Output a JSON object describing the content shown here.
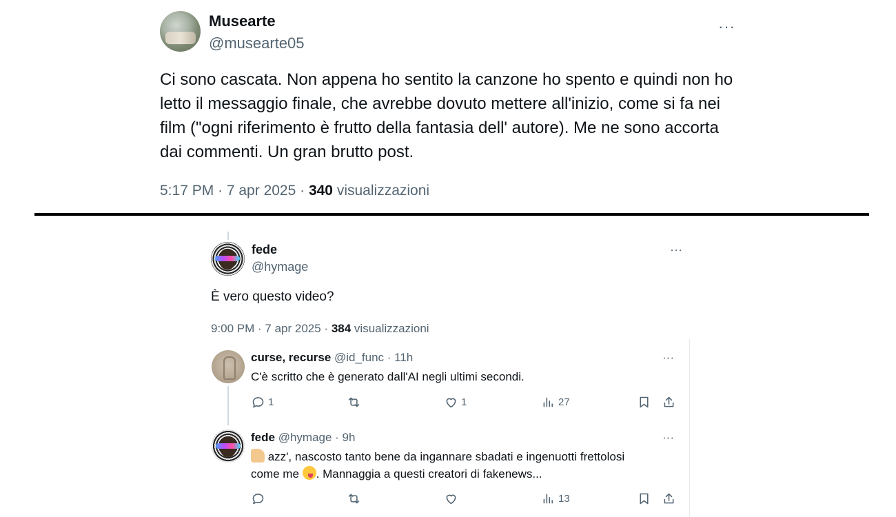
{
  "top_tweet": {
    "name": "Musearte",
    "handle": "@musearte05",
    "more": "···",
    "text": "Ci sono cascata. Non appena ho sentito la canzone ho spento e quindi non ho letto il messaggio finale, che avrebbe dovuto mettere all'inizio, come si fa nei film (\"ogni riferimento è frutto della fantasia dell' autore). Me ne sono accorta dai commenti. Un gran brutto post.",
    "time": "5:17 PM · 7 apr 2025 · ",
    "views": "340",
    "views_label": " visualizzazioni"
  },
  "second_tweet": {
    "name": "fede",
    "handle": "@hymage",
    "more": "···",
    "text": "È vero questo video?",
    "time": "9:00 PM · 7 apr 2025 · ",
    "views": "384",
    "views_label": " visualizzazioni"
  },
  "replies": [
    {
      "name": "curse, recurse",
      "meta": " @id_func · 11h",
      "more": "···",
      "text": "C'è scritto che è generato dall'AI negli ultimi secondi.",
      "reply_count": "1",
      "retweet_count": "",
      "like_count": "1",
      "view_count": "27"
    },
    {
      "name": "fede",
      "meta": " @hymage · 9h",
      "more": "···",
      "text_part1": " azz', nascosto tanto bene da ingannare sbadati e ingenuotti frettolosi",
      "text_part2_a": "come me ",
      "text_part2_b": ". Mannaggia a questi creatori di fakenews...",
      "reply_count": "",
      "retweet_count": "",
      "like_count": "",
      "view_count": "13"
    }
  ],
  "icons": {
    "reply": "reply-icon",
    "retweet": "retweet-icon",
    "like": "heart-icon",
    "views": "views-icon",
    "bookmark": "bookmark-icon",
    "share": "share-icon"
  },
  "colors": {
    "text": "#0f1419",
    "secondary": "#536471",
    "divider": "#000000"
  }
}
